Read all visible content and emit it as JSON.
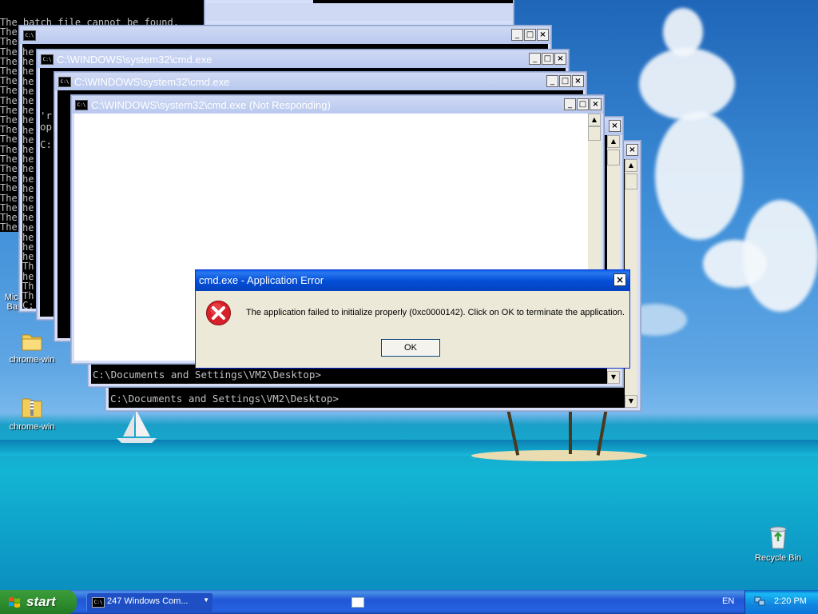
{
  "desktop": {
    "icons": [
      {
        "label_line1": "Microsoft",
        "label_line2": "Basic"
      },
      {
        "label": "chrome-win"
      },
      {
        "label": "chrome-win"
      },
      {
        "label": "Recycle Bin"
      }
    ]
  },
  "back_console": {
    "lines_left": [
      "The batch file cannot be found.",
      "The",
      "The",
      "The",
      "The",
      "The",
      "The",
      "The",
      "The",
      "The",
      "The",
      "The",
      "The",
      "The",
      "The",
      "The",
      "The",
      "The",
      "The",
      "The",
      "The",
      "The"
    ],
    "he_lines": [
      "he",
      "he",
      "he",
      "he",
      "he",
      "he",
      "he",
      "he",
      "he",
      "he",
      "he",
      "he",
      "he",
      "he",
      "he",
      "he",
      "he",
      "he",
      "he",
      "he",
      "he",
      "he",
      "Th",
      "he",
      "Th",
      "Th",
      "C:"
    ]
  },
  "windows": {
    "w1": {
      "title": ""
    },
    "w2": {
      "title": "C:\\WINDOWS\\system32\\cmd.exe"
    },
    "w3": {
      "title": "C:\\WINDOWS\\system32\\cmd.exe"
    },
    "w4": {
      "title": "C:\\WINDOWS\\system32\\cmd.exe (Not Responding)"
    },
    "prompt_a": "C:\\Documents and Settings\\VM2\\Desktop>",
    "prompt_b": "C:\\Documents and Settings\\VM2\\Desktop>",
    "frag_a": "'r",
    "frag_b": "op",
    "frag_c": "C:"
  },
  "dialog": {
    "title": "cmd.exe - Application Error",
    "message": "The application failed to initialize properly (0xc0000142). Click on OK to terminate the application.",
    "ok_label": "OK"
  },
  "taskbar": {
    "start_label": "start",
    "group_label": "247 Windows Com...",
    "language": "EN",
    "clock": "2:20 PM"
  },
  "colors": {
    "xp_blue": "#0450d8",
    "start_green": "#2f8f2f",
    "error_red": "#d8202a"
  }
}
